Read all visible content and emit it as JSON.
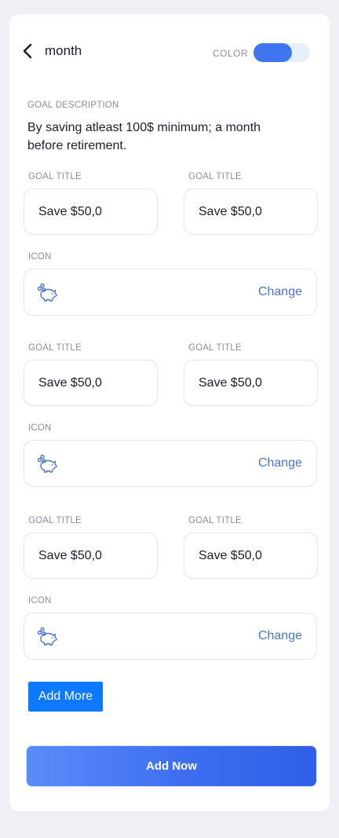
{
  "header": {
    "title": "month",
    "color_label": "COLOR",
    "color_toggle_on": true,
    "accent": "#3f75ef"
  },
  "description": {
    "label": "GOAL DESCRIPTION",
    "text": "By saving atleast 100$ minimum; a month before retirement."
  },
  "goals": [
    {
      "left_label": "GOAL TITLE",
      "left_value": "Save $50,0",
      "right_label": "GOAL TITLE",
      "right_value": "Save $50,0",
      "icon_label": "ICON",
      "icon": "piggy-bank-icon",
      "change_label": "Change"
    },
    {
      "left_label": "GOAL TITLE",
      "left_value": "Save $50,0",
      "right_label": "GOAL TITLE",
      "right_value": "Save $50,0",
      "icon_label": "ICON",
      "icon": "piggy-bank-icon",
      "change_label": "Change"
    },
    {
      "left_label": "GOAL TITLE",
      "left_value": "Save $50,0",
      "right_label": "GOAL TITLE",
      "right_value": "Save $50,0",
      "icon_label": "ICON",
      "icon": "piggy-bank-icon",
      "change_label": "Change"
    }
  ],
  "actions": {
    "add_more": "Add More",
    "add_now": "Add Now",
    "add_more_color": "#0d79ff"
  }
}
